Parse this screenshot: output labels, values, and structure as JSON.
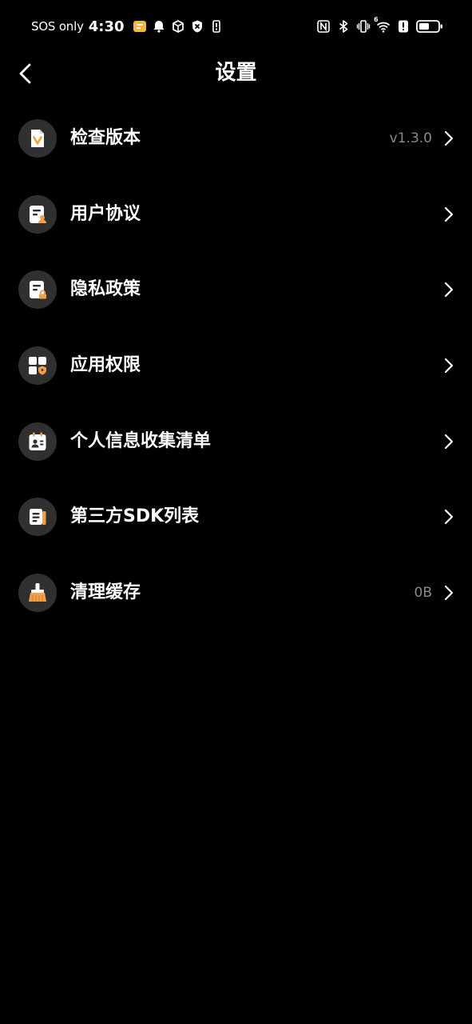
{
  "status_bar": {
    "carrier": "SOS only",
    "time": "4:30",
    "left_icons": [
      "app-notification-icon",
      "bell-icon",
      "box-icon",
      "shield-x-icon",
      "alert-battery-icon"
    ],
    "right_icons": [
      "nfc-icon",
      "bluetooth-icon",
      "vibrate-icon",
      "wifi-icon",
      "alert-icon",
      "battery-icon"
    ],
    "wifi_label": "6"
  },
  "header": {
    "title": "设置",
    "back_icon": "chevron-left-icon"
  },
  "settings": {
    "items": [
      {
        "label": "检查版本",
        "value": "v1.3.0",
        "icon": "version-check-icon"
      },
      {
        "label": "用户协议",
        "value": "",
        "icon": "user-agreement-icon"
      },
      {
        "label": "隐私政策",
        "value": "",
        "icon": "privacy-policy-icon"
      },
      {
        "label": "应用权限",
        "value": "",
        "icon": "app-permissions-icon"
      },
      {
        "label": "个人信息收集清单",
        "value": "",
        "icon": "personal-info-icon"
      },
      {
        "label": "第三方SDK列表",
        "value": "",
        "icon": "sdk-list-icon"
      },
      {
        "label": "清理缓存",
        "value": "0B",
        "icon": "broom-icon"
      }
    ]
  },
  "colors": {
    "background": "#000000",
    "icon_circle": "#303030",
    "accent_orange": "#f0a04b",
    "value_gray": "#8a8a8a",
    "text": "#ffffff"
  }
}
